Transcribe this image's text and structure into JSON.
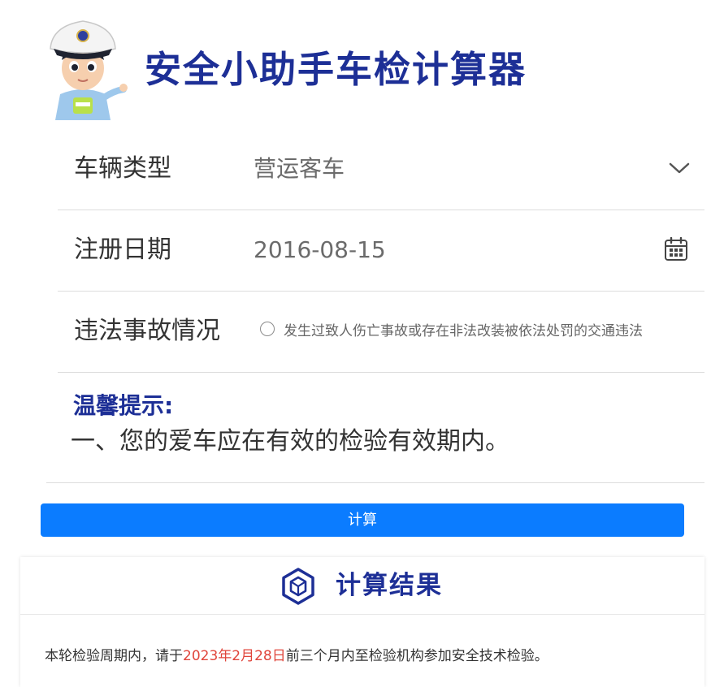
{
  "header": {
    "title": "安全小助手车检计算器"
  },
  "form": {
    "vehicle_type": {
      "label": "车辆类型",
      "value": "营运客车"
    },
    "register_date": {
      "label": "注册日期",
      "value": "2016-08-15"
    },
    "violation": {
      "label": "违法事故情况",
      "option_text": "发生过致人伤亡事故或存在非法改装被依法处罚的交通违法",
      "checked": false
    }
  },
  "tips": {
    "title": "温馨提示:",
    "items": [
      "一、您的爱车应在有效的检验有效期内。"
    ]
  },
  "calculate_button": {
    "label": "计算"
  },
  "result": {
    "title": "计算结果",
    "text_before": "本轮检验周期内，请于",
    "highlight_date": "2023年2月28日",
    "text_after": "前三个月内至检验机构参加安全技术检验。"
  },
  "colors": {
    "brand_blue": "#1d2f96",
    "button_blue": "#0b7cff",
    "highlight_red": "#e0453b"
  },
  "icons": {
    "mascot": "police-mascot-icon",
    "dropdown": "chevron-down-icon",
    "date_picker": "calendar-icon",
    "result": "hexagon-cube-icon"
  }
}
